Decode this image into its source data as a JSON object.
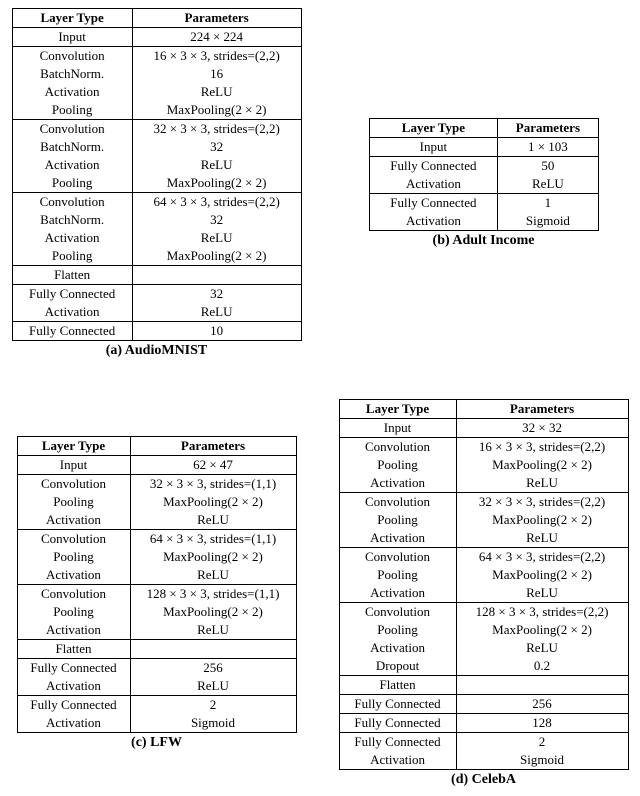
{
  "tables": {
    "a": {
      "caption": "(a) AudioMNIST",
      "headers": [
        "Layer Type",
        "Parameters"
      ],
      "rows": [
        {
          "cells": [
            "Input",
            "224 × 224"
          ],
          "sep": true
        },
        {
          "cells": [
            "Convolution",
            "16 × 3 × 3, strides=(2,2)"
          ]
        },
        {
          "cells": [
            "BatchNorm.",
            "16"
          ]
        },
        {
          "cells": [
            "Activation",
            "ReLU"
          ]
        },
        {
          "cells": [
            "Pooling",
            "MaxPooling(2 × 2)"
          ],
          "sep": true
        },
        {
          "cells": [
            "Convolution",
            "32 × 3 × 3, strides=(2,2)"
          ]
        },
        {
          "cells": [
            "BatchNorm.",
            "32"
          ]
        },
        {
          "cells": [
            "Activation",
            "ReLU"
          ]
        },
        {
          "cells": [
            "Pooling",
            "MaxPooling(2 × 2)"
          ],
          "sep": true
        },
        {
          "cells": [
            "Convolution",
            "64 × 3 × 3, strides=(2,2)"
          ]
        },
        {
          "cells": [
            "BatchNorm.",
            "32"
          ]
        },
        {
          "cells": [
            "Activation",
            "ReLU"
          ]
        },
        {
          "cells": [
            "Pooling",
            "MaxPooling(2 × 2)"
          ],
          "sep": true
        },
        {
          "cells": [
            "Flatten",
            ""
          ],
          "sep": true
        },
        {
          "cells": [
            "Fully Connected",
            "32"
          ]
        },
        {
          "cells": [
            "Activation",
            "ReLU"
          ],
          "sep": true
        },
        {
          "cells": [
            "Fully Connected",
            "10"
          ],
          "last": true
        }
      ]
    },
    "b": {
      "caption": "(b) Adult Income",
      "headers": [
        "Layer Type",
        "Parameters"
      ],
      "rows": [
        {
          "cells": [
            "Input",
            "1 × 103"
          ],
          "sep": true
        },
        {
          "cells": [
            "Fully Connected",
            "50"
          ]
        },
        {
          "cells": [
            "Activation",
            "ReLU"
          ],
          "sep": true
        },
        {
          "cells": [
            "Fully Connected",
            "1"
          ]
        },
        {
          "cells": [
            "Activation",
            "Sigmoid"
          ],
          "last": true
        }
      ]
    },
    "c": {
      "caption": "(c) LFW",
      "headers": [
        "Layer Type",
        "Parameters"
      ],
      "rows": [
        {
          "cells": [
            "Input",
            "62 × 47"
          ],
          "sep": true
        },
        {
          "cells": [
            "Convolution",
            "32 × 3 × 3, strides=(1,1)"
          ]
        },
        {
          "cells": [
            "Pooling",
            "MaxPooling(2 × 2)"
          ]
        },
        {
          "cells": [
            "Activation",
            "ReLU"
          ],
          "sep": true
        },
        {
          "cells": [
            "Convolution",
            "64 × 3 × 3, strides=(1,1)"
          ]
        },
        {
          "cells": [
            "Pooling",
            "MaxPooling(2 × 2)"
          ]
        },
        {
          "cells": [
            "Activation",
            "ReLU"
          ],
          "sep": true
        },
        {
          "cells": [
            "Convolution",
            "128 × 3 × 3, strides=(1,1)"
          ]
        },
        {
          "cells": [
            "Pooling",
            "MaxPooling(2 × 2)"
          ]
        },
        {
          "cells": [
            "Activation",
            "ReLU"
          ],
          "sep": true
        },
        {
          "cells": [
            "Flatten",
            ""
          ],
          "sep": true
        },
        {
          "cells": [
            "Fully Connected",
            "256"
          ]
        },
        {
          "cells": [
            "Activation",
            "ReLU"
          ],
          "sep": true
        },
        {
          "cells": [
            "Fully Connected",
            "2"
          ]
        },
        {
          "cells": [
            "Activation",
            "Sigmoid"
          ],
          "last": true
        }
      ]
    },
    "d": {
      "caption": "(d) CelebA",
      "headers": [
        "Layer Type",
        "Parameters"
      ],
      "rows": [
        {
          "cells": [
            "Input",
            "32 × 32"
          ],
          "sep": true
        },
        {
          "cells": [
            "Convolution",
            "16 × 3 × 3, strides=(2,2)"
          ]
        },
        {
          "cells": [
            "Pooling",
            "MaxPooling(2 × 2)"
          ]
        },
        {
          "cells": [
            "Activation",
            "ReLU"
          ],
          "sep": true
        },
        {
          "cells": [
            "Convolution",
            "32 × 3 × 3, strides=(2,2)"
          ]
        },
        {
          "cells": [
            "Pooling",
            "MaxPooling(2 × 2)"
          ]
        },
        {
          "cells": [
            "Activation",
            "ReLU"
          ],
          "sep": true
        },
        {
          "cells": [
            "Convolution",
            "64 × 3 × 3, strides=(2,2)"
          ]
        },
        {
          "cells": [
            "Pooling",
            "MaxPooling(2 × 2)"
          ]
        },
        {
          "cells": [
            "Activation",
            "ReLU"
          ],
          "sep": true
        },
        {
          "cells": [
            "Convolution",
            "128 × 3 × 3, strides=(2,2)"
          ]
        },
        {
          "cells": [
            "Pooling",
            "MaxPooling(2 × 2)"
          ]
        },
        {
          "cells": [
            "Activation",
            "ReLU"
          ]
        },
        {
          "cells": [
            "Dropout",
            "0.2"
          ],
          "sep": true
        },
        {
          "cells": [
            "Flatten",
            ""
          ],
          "sep": true
        },
        {
          "cells": [
            "Fully Connected",
            "256"
          ],
          "sep": true
        },
        {
          "cells": [
            "Fully Connected",
            "128"
          ],
          "sep": true
        },
        {
          "cells": [
            "Fully Connected",
            "2"
          ]
        },
        {
          "cells": [
            "Activation",
            "Sigmoid"
          ],
          "last": true
        }
      ]
    }
  }
}
